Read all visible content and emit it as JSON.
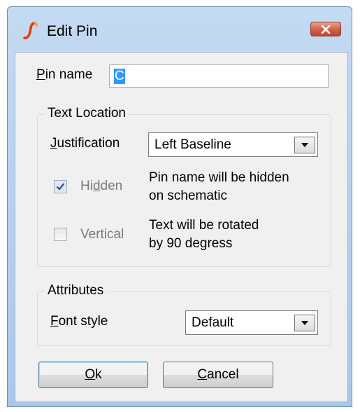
{
  "dialog": {
    "title": "Edit Pin",
    "close_symbol": "✕",
    "app_icon": "simetrix-logo-icon"
  },
  "pin_name": {
    "label_first": "P",
    "label_rest": "in name",
    "value": "C"
  },
  "text_location": {
    "group_label": "Text Location",
    "justification_label_first": "J",
    "justification_label_rest": "ustification",
    "justification_value": "Left Baseline",
    "hidden": {
      "label_first": "Hi",
      "label_accel": "d",
      "label_rest": "den",
      "checked": true,
      "desc_line1": "Pin name will be hidden",
      "desc_line2": "on schematic"
    },
    "vertical": {
      "label": "Vertical",
      "checked": false,
      "desc_line1": "Text will be rotated",
      "desc_line2": "by 90 degress"
    }
  },
  "attributes": {
    "group_label": "Attributes",
    "font_style_label_first": "F",
    "font_style_label_rest": "ont style",
    "font_style_value": "Default"
  },
  "buttons": {
    "ok_first": "O",
    "ok_rest": "k",
    "cancel_first": "C",
    "cancel_rest": "ancel"
  },
  "colors": {
    "accent": "#3399ff",
    "close_button": "#c2432b"
  }
}
